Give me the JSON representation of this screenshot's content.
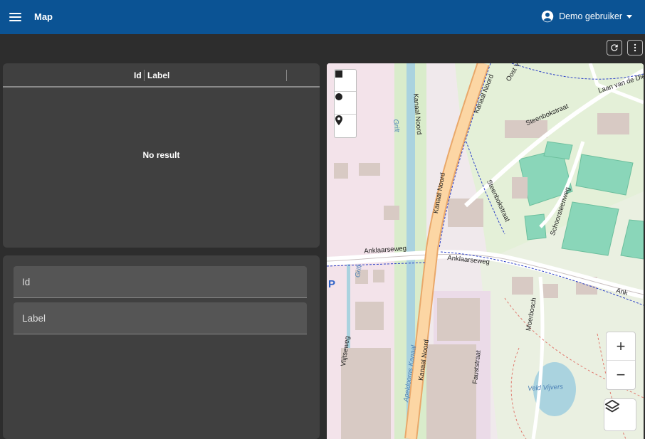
{
  "appbar": {
    "menu_icon": "menu-icon",
    "title": "Map",
    "user_name": "Demo gebruiker",
    "user_icon": "account-circle-icon",
    "caret_icon": "caret-down-icon",
    "background": "#0b5394"
  },
  "toolbar": {
    "refresh_icon": "refresh-icon",
    "more_icon": "more-vertical-icon"
  },
  "table": {
    "columns": [
      "Id",
      "Label"
    ],
    "empty_text": "No result"
  },
  "form": {
    "fields": [
      {
        "label": "Id"
      },
      {
        "label": "Label"
      }
    ]
  },
  "map": {
    "draw_tools": [
      "square-icon",
      "circle-icon",
      "marker-icon"
    ],
    "zoom_in": "+",
    "zoom_out": "−",
    "layers_icon": "layers-icon",
    "parking_symbol": "P",
    "labels": {
      "kanaal_noord": "Kanaal Noord",
      "kanaal_noord_canal": "Kanaal Noord",
      "grift": "Grift",
      "oost": "Oost Ve",
      "laan": "Laan van de Dier",
      "steenbokstraat": "Steenbokstraat",
      "steenbokstraat2": "Steenbokstraat",
      "schoorsteen": "Schoorsteenweg",
      "anklaarseweg_w": "Anklaarseweg",
      "anklaarseweg_e": "Anklaarseweg",
      "anklaarseweg_far": "Ank",
      "vlijtseweg": "Vlijtseweg",
      "apeldoorns": "Apeldoorns Kanaal",
      "faust": "Fauststraat",
      "moerbosch": "Moerbosch",
      "veld_vijvers": "Veld Vijvers",
      "grift2": "Grift"
    }
  }
}
